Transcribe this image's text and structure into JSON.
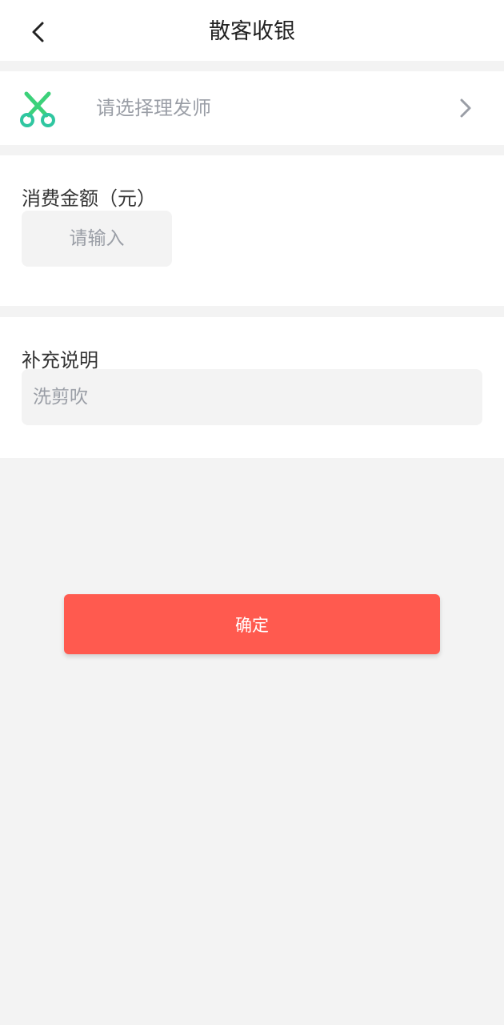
{
  "header": {
    "title": "散客收银",
    "back_icon": "chevron-left-icon"
  },
  "stylist": {
    "placeholder": "请选择理发师",
    "icon": "scissors-icon",
    "icon_color": "#3cd17a",
    "arrow_icon": "chevron-right-icon"
  },
  "amount": {
    "label": "消费金额（元）",
    "placeholder": "请输入",
    "value": ""
  },
  "note": {
    "label": "补充说明",
    "placeholder": "洗剪吹",
    "value": ""
  },
  "confirm": {
    "label": "确定",
    "color": "#ff5a4f"
  }
}
